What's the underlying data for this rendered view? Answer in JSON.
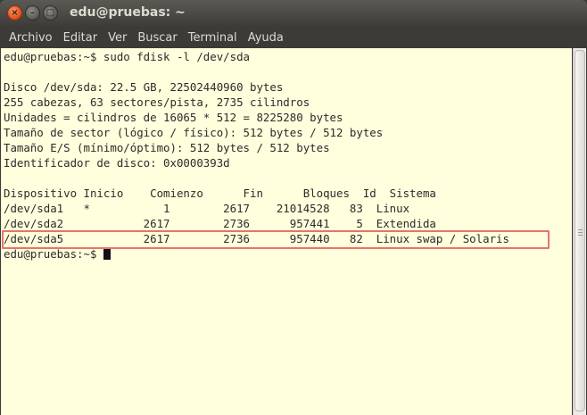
{
  "window": {
    "title": "edu@pruebas: ~",
    "buttons": {
      "close_glyph": "×",
      "minimize_glyph": "–",
      "maximize_glyph": "□"
    }
  },
  "menubar": [
    "Archivo",
    "Editar",
    "Ver",
    "Buscar",
    "Terminal",
    "Ayuda"
  ],
  "terminal": {
    "command_line": "edu@pruebas:~$ sudo fdisk -l /dev/sda",
    "info_lines": [
      "Disco /dev/sda: 22.5 GB, 22502440960 bytes",
      "255 cabezas, 63 sectores/pista, 2735 cilindros",
      "Unidades = cilindros de 16065 * 512 = 8225280 bytes",
      "Tamaño de sector (lógico / físico): 512 bytes / 512 bytes",
      "Tamaño E/S (mínimo/óptimo): 512 bytes / 512 bytes",
      "Identificador de disco: 0x0000393d"
    ],
    "table_header": "Dispositivo Inicio    Comienzo      Fin      Bloques  Id  Sistema",
    "rows": [
      "/dev/sda1   *           1        2617    21014528   83  Linux",
      "/dev/sda2            2617        2736      957441    5  Extendida",
      "/dev/sda5            2617        2736      957440   82  Linux swap / Solaris"
    ],
    "prompt": "edu@pruebas:~$ "
  },
  "colors": {
    "terminal_bg": "#ffffdd",
    "highlight_border": "#e8746a",
    "titlebar": "#3c3b37"
  }
}
